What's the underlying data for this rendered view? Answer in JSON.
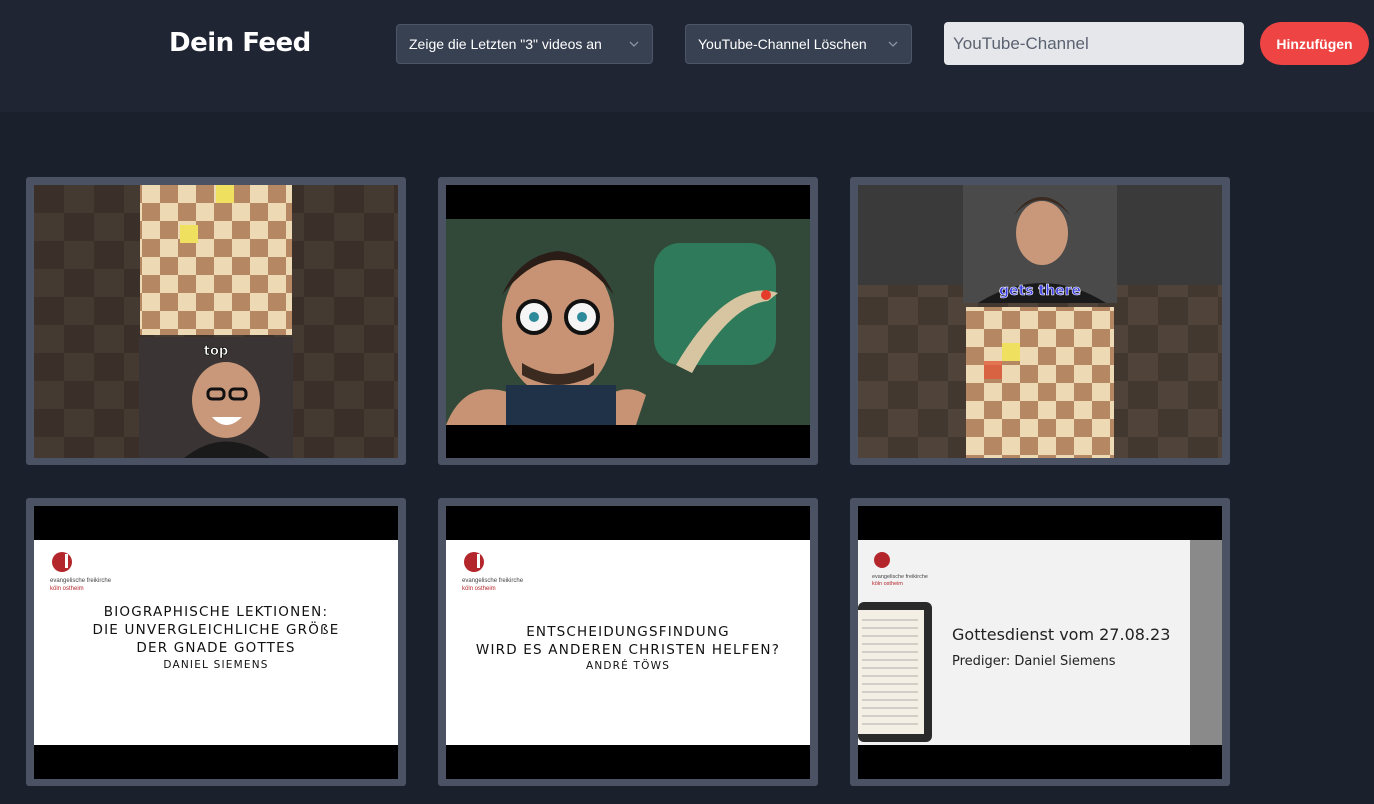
{
  "header": {
    "title": "Dein Feed",
    "video_count_select": "Zeige die Letzten \"3\" videos an",
    "delete_channel_select": "YouTube-Channel Löschen",
    "channel_input_placeholder": "YouTube-Channel",
    "channel_input_value": "",
    "add_button": "Hinzufügen"
  },
  "videos": [
    {
      "overlay_caption": "top"
    },
    {},
    {
      "overlay_caption": "gets there"
    },
    {
      "logo_line1": "evangelische freikirche",
      "logo_line2": "köln ostheim",
      "lines": [
        "BIOGRAPHISCHE LEKTIONEN:",
        "DIE UNVERGLEICHLICHE GRÖßE",
        "DER GNADE GOTTES"
      ],
      "speaker": "DANIEL SIEMENS"
    },
    {
      "logo_line1": "evangelische freikirche",
      "logo_line2": "köln ostheim",
      "lines": [
        "ENTSCHEIDUNGSFINDUNG",
        "WIRD ES ANDEREN CHRISTEN HELFEN?"
      ],
      "speaker": "ANDRÉ TÖWS"
    },
    {
      "logo_line1": "evangelische freikirche",
      "logo_line2": "köln ostheim",
      "title": "Gottesdienst vom 27.08.23",
      "subtitle": "Prediger: Daniel Siemens"
    }
  ],
  "colors": {
    "accent": "#ef4444",
    "background": "#1b212c",
    "header": "#1f2533",
    "card": "#4a5263"
  }
}
